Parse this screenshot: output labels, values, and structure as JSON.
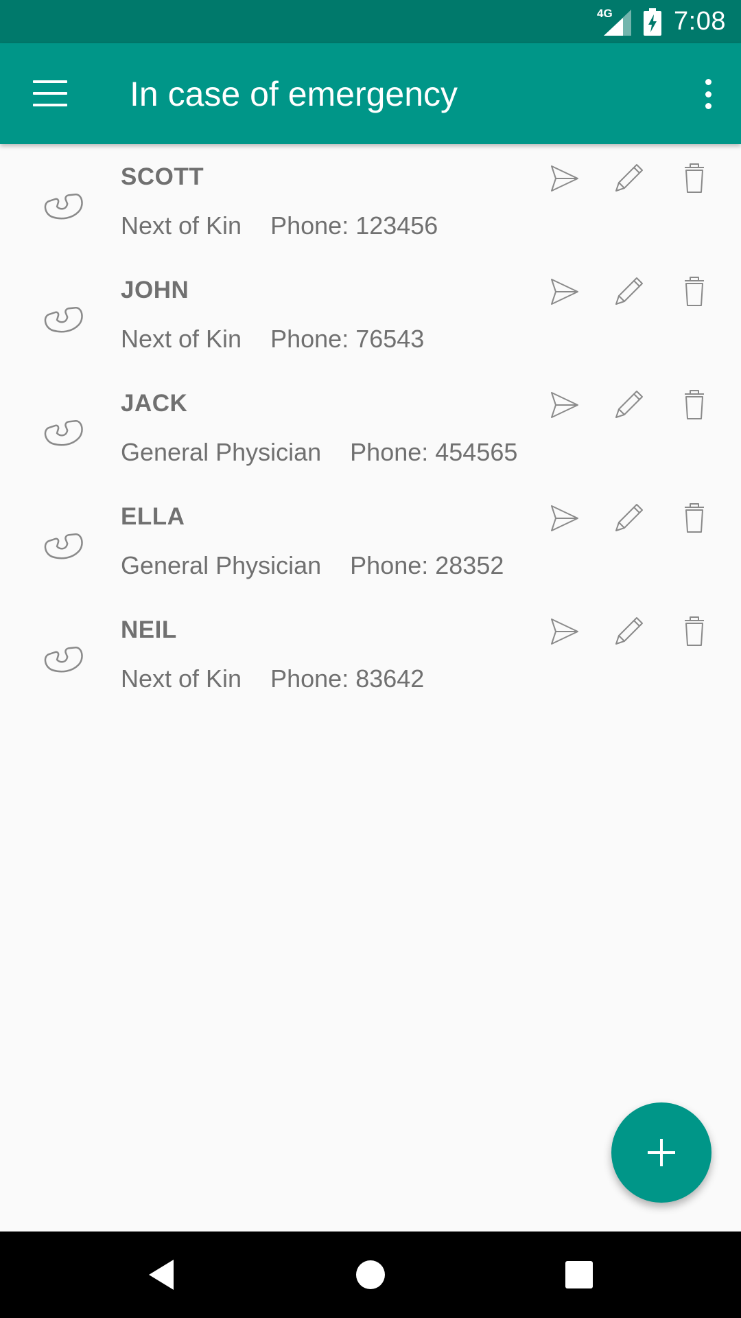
{
  "status_bar": {
    "network_label": "4G",
    "time": "7:08",
    "icons": [
      "signal-icon",
      "battery-charging-icon"
    ]
  },
  "app_bar": {
    "title": "In case of emergency",
    "menu_icon": "hamburger-menu-icon",
    "overflow_icon": "more-vert-icon"
  },
  "contacts": [
    {
      "name": "SCOTT",
      "role": "Next of Kin",
      "phone": "Phone: 123456"
    },
    {
      "name": "JOHN",
      "role": "Next of Kin",
      "phone": "Phone: 76543"
    },
    {
      "name": "JACK",
      "role": "General Physician",
      "phone": "Phone: 454565"
    },
    {
      "name": "ELLA",
      "role": "General Physician",
      "phone": "Phone: 28352"
    },
    {
      "name": "NEIL",
      "role": "Next of Kin",
      "phone": "Phone: 83642"
    }
  ],
  "row_actions": [
    "send-icon",
    "pencil-icon",
    "trash-icon"
  ],
  "fab": {
    "icon": "plus-icon",
    "color": "#009688"
  },
  "colors": {
    "status_bar": "#00796b",
    "app_bar": "#009688",
    "text": "#707070",
    "background": "#fafafa"
  },
  "nav_bar": {
    "icons": [
      "back-icon",
      "home-icon",
      "recents-icon"
    ]
  }
}
